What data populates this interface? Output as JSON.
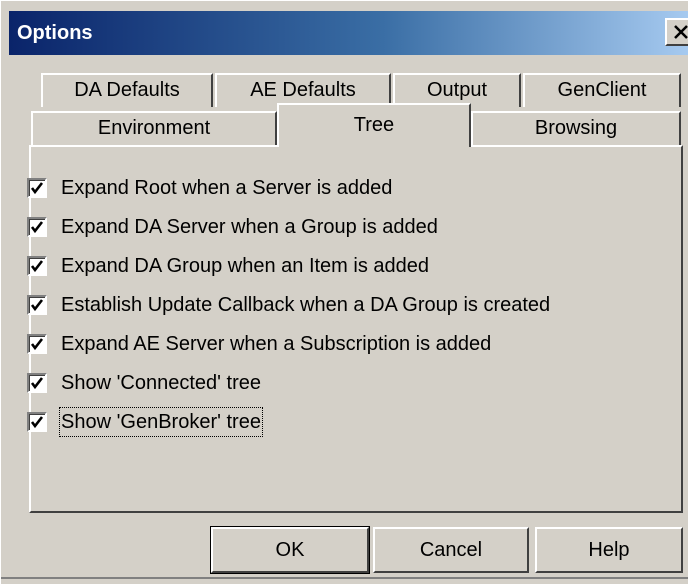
{
  "window": {
    "title": "Options",
    "close_label": "×"
  },
  "tabs_row1": [
    {
      "label": "DA Defaults"
    },
    {
      "label": "AE Defaults"
    },
    {
      "label": "Output"
    },
    {
      "label": "GenClient"
    }
  ],
  "tabs_row2": [
    {
      "label": "Environment"
    },
    {
      "label": "Tree",
      "active": true
    },
    {
      "label": "Browsing"
    }
  ],
  "options": [
    {
      "label": "Expand Root when a Server is added",
      "checked": true
    },
    {
      "label": "Expand DA Server when a Group is added",
      "checked": true
    },
    {
      "label": "Expand DA Group when an Item is added",
      "checked": true
    },
    {
      "label": "Establish Update Callback when a DA Group is created",
      "checked": true
    },
    {
      "label": "Expand AE Server when a Subscription is added",
      "checked": true
    },
    {
      "label": "Show 'Connected' tree",
      "checked": true
    },
    {
      "label": "Show 'GenBroker' tree",
      "checked": true,
      "focused": true
    }
  ],
  "buttons": {
    "ok": "OK",
    "cancel": "Cancel",
    "help": "Help"
  }
}
